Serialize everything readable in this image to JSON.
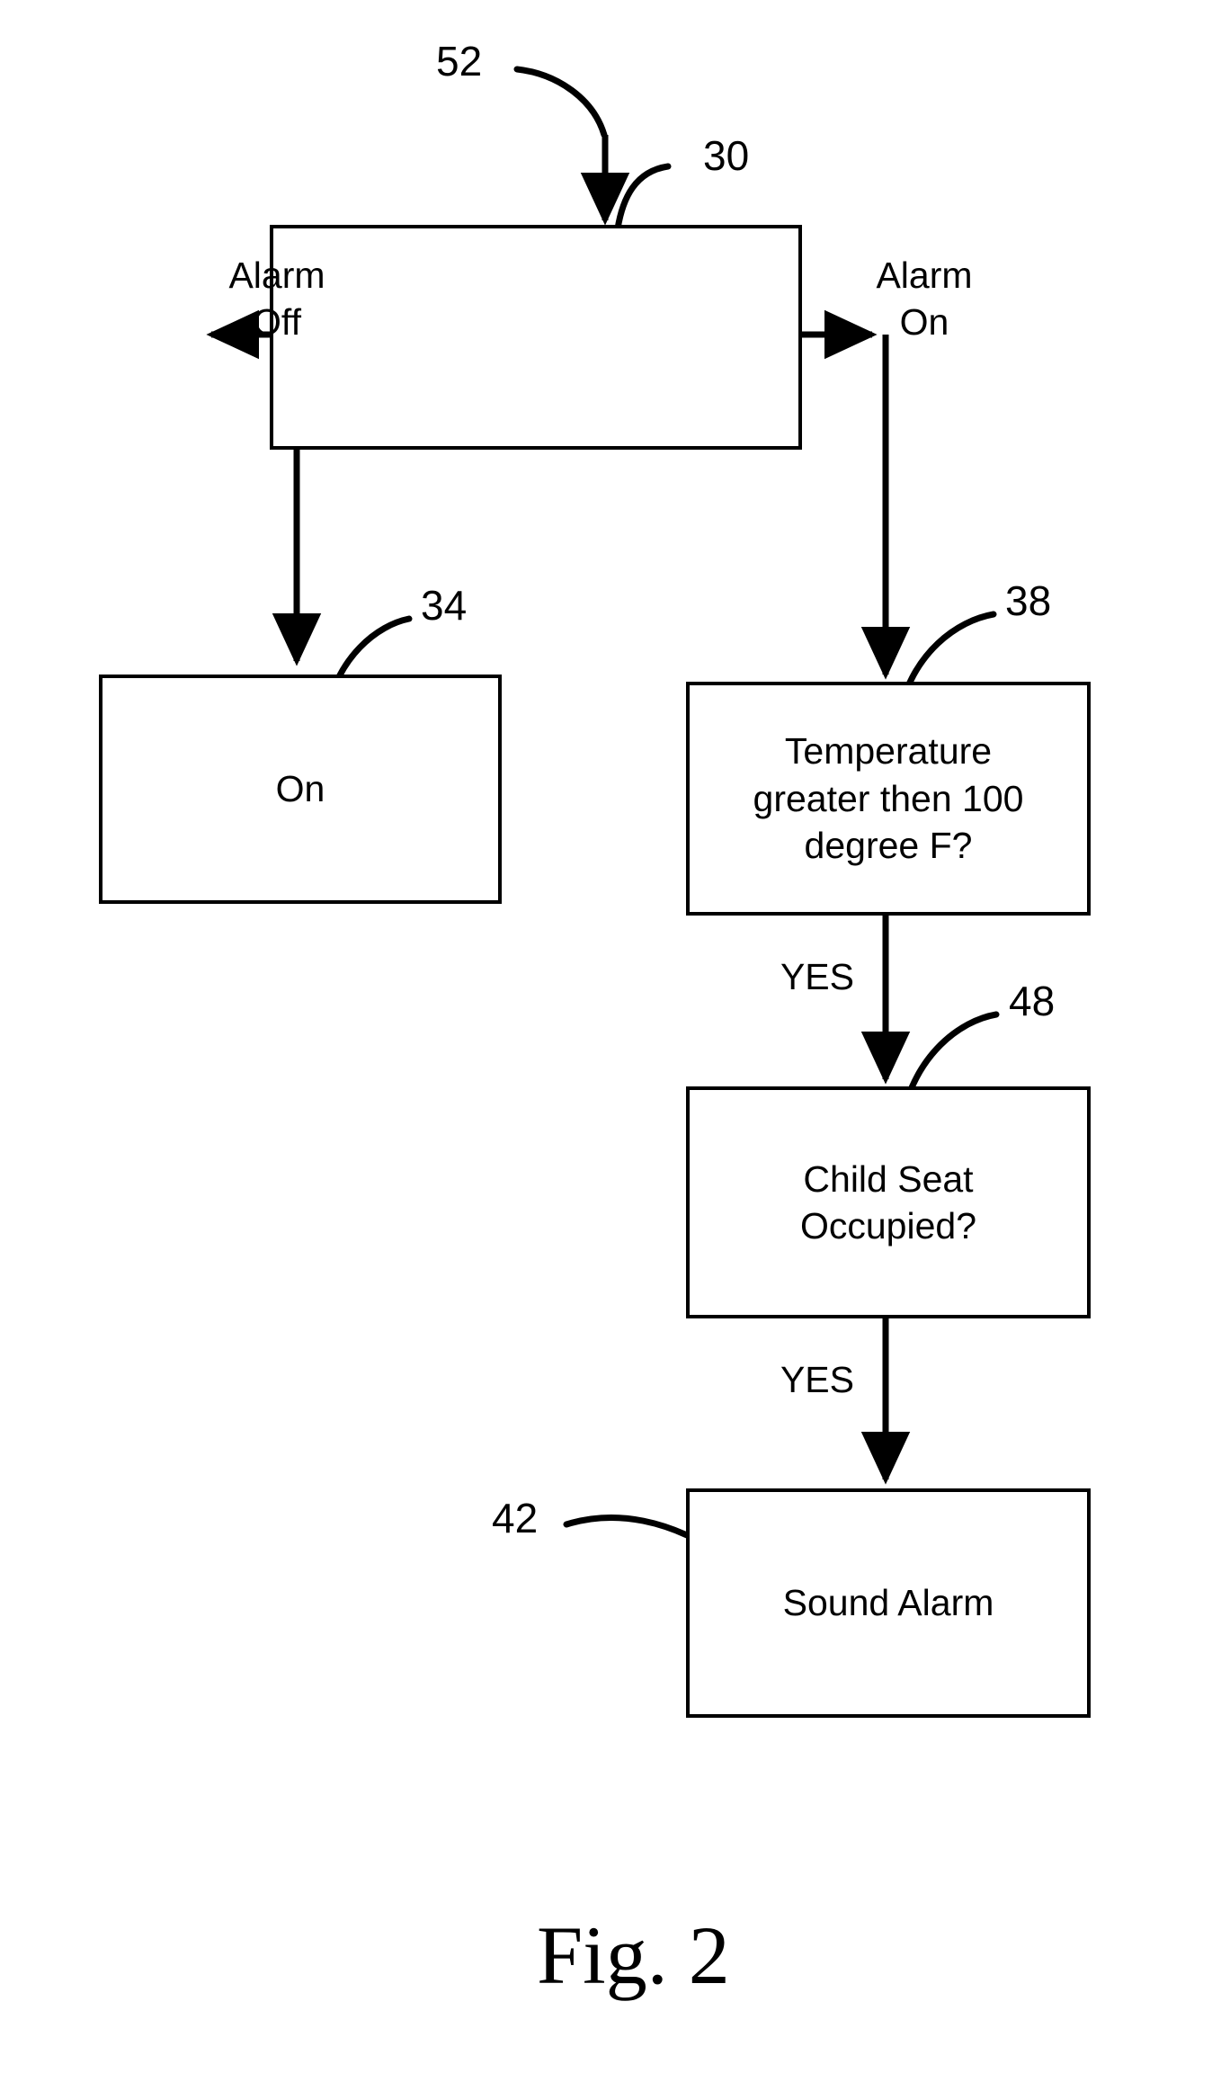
{
  "figure": {
    "caption": "Fig. 2",
    "ink_color": "#000000",
    "background_color": "#ffffff"
  },
  "reference_numerals": {
    "controller": "52",
    "alarm_switch": "30",
    "on_box": "34",
    "temperature_box": "38",
    "child_seat_box": "48",
    "sound_alarm_box": "42"
  },
  "boxes": {
    "alarm_switch": {
      "label": ""
    },
    "on_state": {
      "label": "On"
    },
    "temperature_decision": {
      "label": "Temperature\ngreater then 100\ndegree F?"
    },
    "child_seat_decision": {
      "label": "Child Seat\nOccupied?"
    },
    "sound_alarm": {
      "label": "Sound Alarm"
    }
  },
  "branch_labels": {
    "alarm_off": "Alarm\nOff",
    "alarm_on": "Alarm\nOn"
  },
  "edge_labels": {
    "temperature_yes": "YES",
    "child_seat_yes": "YES"
  },
  "flow_description": {
    "type": "flowchart",
    "nodes": [
      {
        "id": "30",
        "text": "",
        "role": "alarm-switch"
      },
      {
        "id": "34",
        "text": "On",
        "role": "state"
      },
      {
        "id": "38",
        "text": "Temperature greater then 100 degree F?",
        "role": "decision"
      },
      {
        "id": "48",
        "text": "Child Seat Occupied?",
        "role": "decision"
      },
      {
        "id": "42",
        "text": "Sound Alarm",
        "role": "action"
      }
    ],
    "edges": [
      {
        "from": "52",
        "to": "30",
        "label": ""
      },
      {
        "from": "30",
        "to": "34",
        "label": "Alarm Off"
      },
      {
        "from": "30",
        "to": "38",
        "label": "Alarm On"
      },
      {
        "from": "38",
        "to": "48",
        "label": "YES"
      },
      {
        "from": "48",
        "to": "42",
        "label": "YES"
      }
    ]
  }
}
